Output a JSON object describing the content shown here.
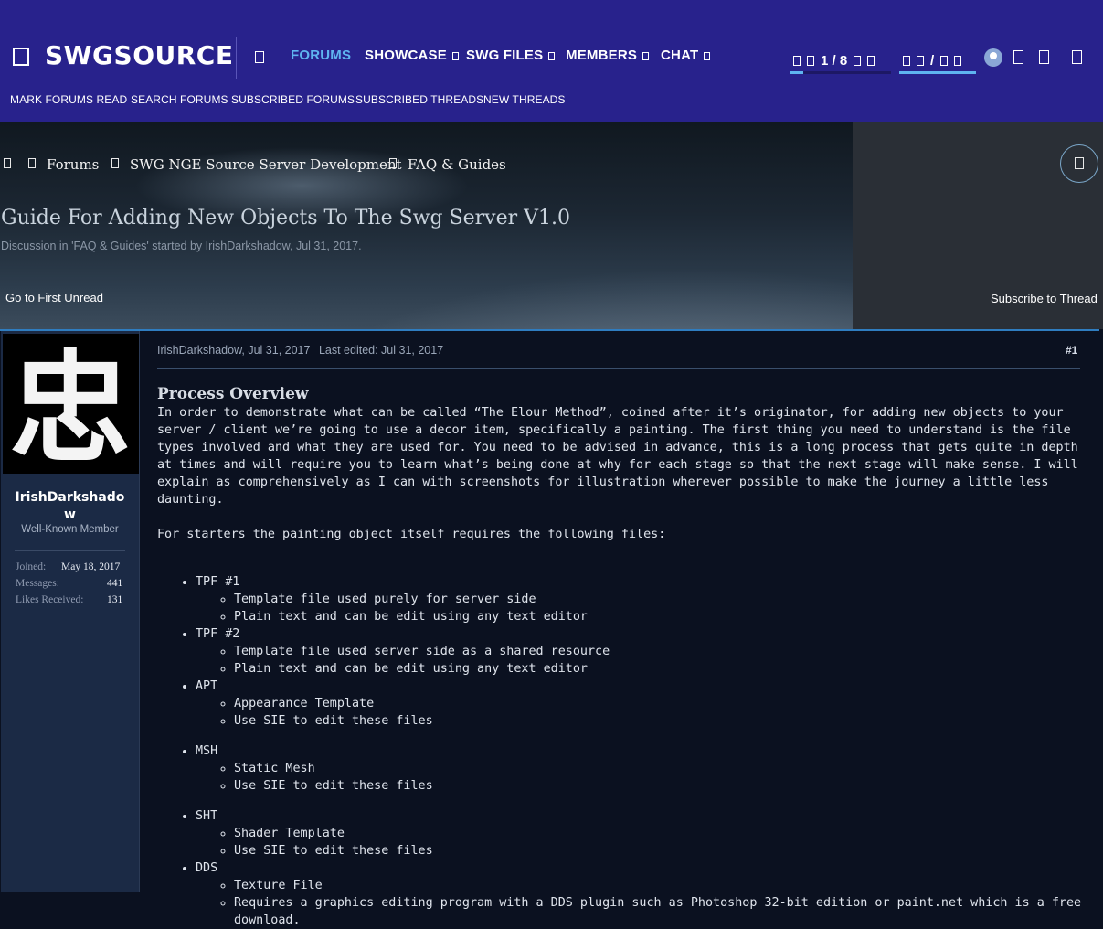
{
  "header": {
    "logo": "SWGSOURCE",
    "nav": [
      {
        "label": "FORUMS",
        "active": true
      },
      {
        "label": "SHOWCASE"
      },
      {
        "label": "SWG FILES"
      },
      {
        "label": "MEMBERS"
      },
      {
        "label": "CHAT"
      }
    ],
    "counter1": "1 / 8",
    "counter2": "/",
    "subnav": [
      "MARK FORUMS READ",
      "SEARCH FORUMS",
      "SUBSCRIBED FORUMS",
      "SUBSCRIBED THREADS",
      "NEW THREADS"
    ],
    "colors": {
      "bar": "#28228c",
      "active": "#5fb4f0"
    }
  },
  "breadcrumb": [
    "Forums",
    "SWG NGE Source Server Development",
    "FAQ & Guides"
  ],
  "thread": {
    "title": "Guide For Adding New Objects To The Swg Server V1.0",
    "description": "Discussion in 'FAQ & Guides' started by IrishDarkshadow, Jul 31, 2017.",
    "first_unread": "Go to First Unread",
    "subscribe": "Subscribe to Thread"
  },
  "user": {
    "name_line1": "IrishDarkshado",
    "name_line2": "w",
    "avatar_glyph": "忠",
    "title": "Well-Known Member",
    "stats": [
      {
        "label": "Joined:",
        "value": "May 18, 2017"
      },
      {
        "label": "Messages:",
        "value": "441"
      },
      {
        "label": "Likes Received:",
        "value": "131"
      }
    ]
  },
  "post": {
    "author_date": "IrishDarkshadow, Jul 31, 2017",
    "edited": "Last edited: Jul 31, 2017",
    "number": "#1",
    "heading": "Process Overview",
    "intro": "In order to demonstrate what can be called “The Elour Method”, coined after it’s originator, for adding new objects to your server / client we’re going to use a decor item, specifically a painting. The first thing you need to understand is the file types involved and what they are used for. You need to be advised in advance, this is a long process that gets quite in depth at times and will require you to learn what’s being done at why for each stage so that the next stage will make sense. I will explain as comprehensively as I can with screenshots for illustration wherever possible to make the journey a little less daunting.",
    "starters": "For starters the painting object itself requires the following files:",
    "files": [
      {
        "name": "TPF #1",
        "items": [
          "Template file used purely for server side",
          "Plain text and can be edit using any text editor"
        ]
      },
      {
        "name": "TPF #2",
        "items": [
          "Template file used server side as a shared resource",
          "Plain text and can be edit using any text editor"
        ]
      },
      {
        "name": "APT",
        "items": [
          "Appearance Template",
          "Use SIE to edit these files"
        ]
      },
      {
        "name": "MSH",
        "items": [
          "Static Mesh",
          "Use SIE to edit these files"
        ]
      },
      {
        "name": "SHT",
        "items": [
          "Shader Template",
          "Use SIE to edit these files"
        ]
      },
      {
        "name": "DDS",
        "items": [
          "Texture File",
          "Requires a graphics editing program with a DDS plugin such as Photoshop 32-bit edition or paint.net which is a free download."
        ]
      }
    ]
  }
}
